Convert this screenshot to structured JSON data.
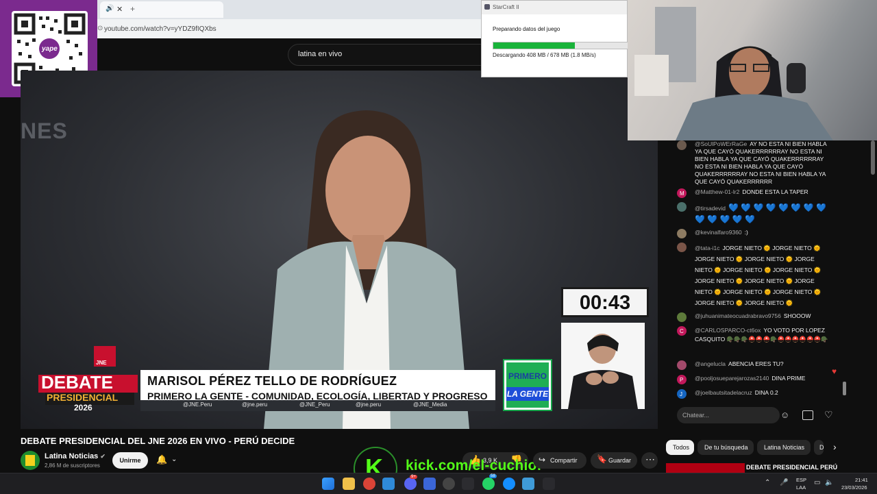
{
  "browser": {
    "url": "youtube.com/watch?v=yYDZ9fIQXbs",
    "search_value": "latina en vivo"
  },
  "overlay_qr": {
    "brand": "yape"
  },
  "video": {
    "ghost_text": "NES",
    "timer": "00:43",
    "candidate_name": "MARISOL PÉREZ TELLO DE RODRÍGUEZ",
    "candidate_party": "PRIMERO LA GENTE - COMUNIDAD, ECOLOGÍA, LIBERTAD Y PROGRESO",
    "socials": [
      "@JNE.Peru",
      "@jne.peru",
      "@JNE_Peru",
      "@jne.peru",
      "@JNE_Media"
    ],
    "debate_logo": {
      "org": "JNE",
      "line1": "DEBATE",
      "line2": "PRESIDENCIAL",
      "year": "2026"
    },
    "party_logo": {
      "line1": "PRIMERO",
      "line2": "LA GENTE"
    }
  },
  "starcraft": {
    "title": "StarCraft II",
    "status": "Preparando datos del juego",
    "progress": 0.6,
    "download_text": "Descargando 408 MB / 678 MB  (1.8 MB/s)"
  },
  "chat": {
    "messages": [
      {
        "author": "@SoUlPoWErRaGe",
        "text": "AY NO ESTA NI BIEN HABLA YA QUE CAYÓ QUAKERRRRRRAY NO ESTA NI BIEN HABLA YA QUE CAYÓ QUAKERRRRRRAY NO ESTA NI BIEN HABLA YA QUE CAYÓ QUAKERRRRRRAY NO ESTA NI BIEN HABLA YA QUE CAYÓ QUAKERRRRRR",
        "avatar_color": "#6b5a4e"
      },
      {
        "author": "@Matthew-01-lr2",
        "text": "DONDE ESTA LA TAPER",
        "avatar_color": "#c2185b",
        "initial": "M"
      },
      {
        "author": "@tirsadevid",
        "text": "💙 💙 💙 💙 💙 💙 💙 💙 💙 💙 💙 💙 💙",
        "avatar_color": "#4a6f6a"
      },
      {
        "author": "@kevinalfaro9360",
        "text": ":)",
        "avatar_color": "#8d7b62"
      },
      {
        "author": "@tata-i1c",
        "text": "JORGE NIETO 🌞 JORGE NIETO 🌞 JORGE NIETO 🌞 JORGE NIETO 🌞 JORGE NIETO 🌞 JORGE NIETO 🌞 JORGE NIETO 🌞 JORGE NIETO 🌞 JORGE NIETO 🌞 JORGE NIETO 🌞 JORGE NIETO 🌞 JORGE NIETO 🌞 JORGE NIETO 🌞 JORGE NIETO 🌞",
        "avatar_color": "#7a5548"
      },
      {
        "author": "@juhuanimateocuadrabravo9756",
        "text": "SHOOOW",
        "avatar_color": "#5d7a3a"
      },
      {
        "author": "@CARLOSPARCO-ct6ox",
        "text": "YO VOTO POR LOPEZ CASQUITO 🪖🪖🪖⛑️⛑️⛑️🪖⛑️⛑️⛑️⛑️⛑️⛑️🪖",
        "avatar_color": "#c2185b",
        "initial": "C"
      },
      {
        "author": "@angelucla",
        "text": "ABENCIA ERES TU?",
        "avatar_color": "#a34a6b"
      },
      {
        "author": "@pooljosueparejarozas2140",
        "text": "DINA PRIME",
        "avatar_color": "#c2185b",
        "initial": "P"
      },
      {
        "author": "@joelbautsitadelacruz",
        "text": "DINA 0.2",
        "avatar_color": "#1565c0",
        "initial": "J"
      }
    ],
    "input_placeholder": "Chatear..."
  },
  "below": {
    "title": "DEBATE PRESIDENCIAL DEL JNE 2026 EN VIVO - PERÚ DECIDE",
    "channel": "Latina Noticias",
    "subscribers": "2,86 M de suscriptores",
    "join": "Unirme",
    "likes": "3,9 K",
    "share": "Compartir",
    "save": "Guardar"
  },
  "chips": [
    "Todos",
    "De tu búsqueda",
    "Latina Noticias",
    "D"
  ],
  "related_title": "DEBATE PRESIDENCIAL PERÚ",
  "kick": {
    "letter": "K",
    "url": "kick.com/el-cuchiof"
  },
  "taskbar": {
    "lang1": "ESP",
    "lang2": "LAA",
    "time": "21:41",
    "date": "23/03/2026",
    "badge_discord": "9+",
    "badge_whatsapp": "58"
  }
}
